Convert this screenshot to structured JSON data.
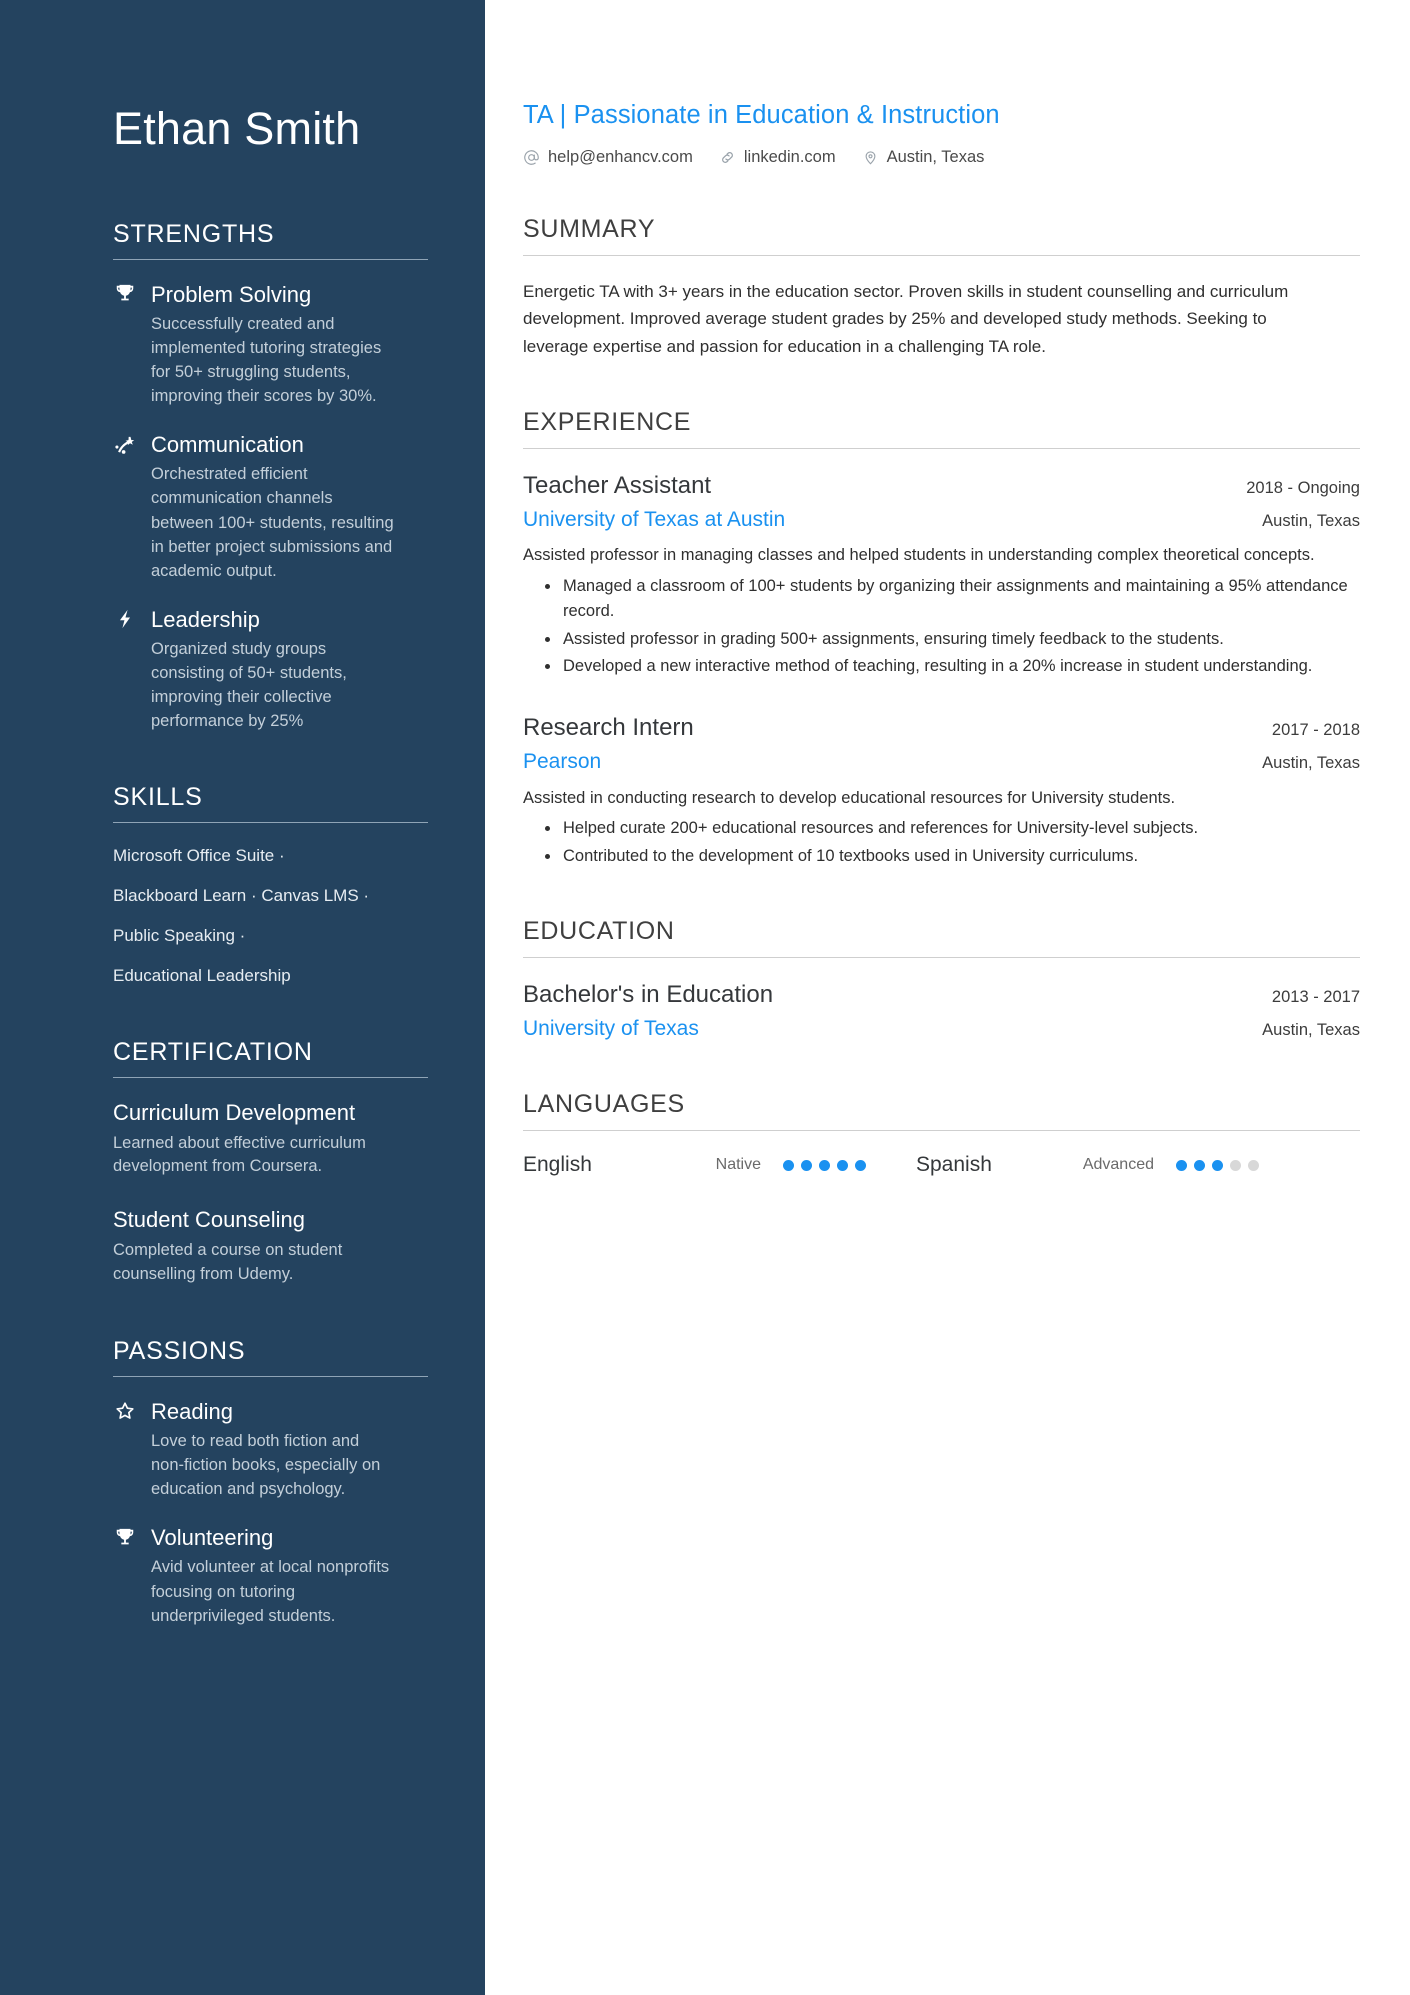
{
  "colors": {
    "sidebar_bg": "#24435f",
    "accent_blue": "#1a91f0",
    "body_text": "#2f2f2f"
  },
  "sidebar": {
    "name": "Ethan Smith",
    "strengths": {
      "heading": "STRENGTHS",
      "items": [
        {
          "icon": "trophy-icon",
          "title": "Problem Solving",
          "description": "Successfully created and implemented tutoring strategies for 50+ struggling students, improving their scores by 30%."
        },
        {
          "icon": "growth-arrow-icon",
          "title": "Communication",
          "description": "Orchestrated efficient communication channels between 100+ students, resulting in better project submissions and academic output."
        },
        {
          "icon": "lightning-bolt-icon",
          "title": "Leadership",
          "description": "Organized study groups consisting of 50+ students, improving their collective performance by 25%"
        }
      ]
    },
    "skills": {
      "heading": "SKILLS",
      "lines": [
        "Microsoft Office Suite ·",
        "Blackboard Learn · Canvas LMS ·",
        "Public Speaking ·",
        "Educational Leadership"
      ]
    },
    "certification": {
      "heading": "CERTIFICATION",
      "items": [
        {
          "title": "Curriculum Development",
          "description": "Learned about effective curriculum development from Coursera."
        },
        {
          "title": "Student Counseling",
          "description": "Completed a course on student counselling from Udemy."
        }
      ]
    },
    "passions": {
      "heading": "PASSIONS",
      "items": [
        {
          "icon": "star-outline-icon",
          "title": "Reading",
          "description": "Love to read both fiction and non-fiction books, especially on education and psychology."
        },
        {
          "icon": "trophy-icon",
          "title": "Volunteering",
          "description": "Avid volunteer at local nonprofits focusing on tutoring underprivileged students."
        }
      ]
    }
  },
  "main": {
    "job_title": "TA | Passionate in Education & Instruction",
    "contact": {
      "email": "help@enhancv.com",
      "email_icon": "at-sign-icon",
      "website": "linkedin.com",
      "website_icon": "link-icon",
      "location": "Austin, Texas",
      "location_icon": "map-pin-icon"
    },
    "summary": {
      "heading": "SUMMARY",
      "text": "Energetic TA with 3+ years in the education sector. Proven skills in student counselling and curriculum development. Improved average student grades by 25% and developed study methods. Seeking to leverage expertise and passion for education in a challenging TA role."
    },
    "experience": {
      "heading": "EXPERIENCE",
      "entries": [
        {
          "title": "Teacher Assistant",
          "date": "2018 - Ongoing",
          "organization": "University of Texas at Austin",
          "location": "Austin, Texas",
          "description": "Assisted professor in managing classes and helped students in understanding complex theoretical concepts.",
          "bullets": [
            "Managed a classroom of 100+ students by organizing their assignments and maintaining a 95% attendance record.",
            "Assisted professor in grading 500+ assignments, ensuring timely feedback to the students.",
            "Developed a new interactive method of teaching, resulting in a 20% increase in student understanding."
          ]
        },
        {
          "title": "Research Intern",
          "date": "2017 - 2018",
          "organization": "Pearson",
          "location": "Austin, Texas",
          "description": "Assisted in conducting research to develop educational resources for University students.",
          "bullets": [
            "Helped curate 200+ educational resources and references for University-level subjects.",
            "Contributed to the development of 10 textbooks used in University curriculums."
          ]
        }
      ]
    },
    "education": {
      "heading": "EDUCATION",
      "entries": [
        {
          "title": "Bachelor's in Education",
          "date": "2013 - 2017",
          "organization": "University of Texas",
          "location": "Austin, Texas"
        }
      ]
    },
    "languages": {
      "heading": "LANGUAGES",
      "items": [
        {
          "name": "English",
          "level": "Native",
          "filled": 5,
          "total": 5
        },
        {
          "name": "Spanish",
          "level": "Advanced",
          "filled": 3,
          "total": 5
        }
      ]
    }
  }
}
